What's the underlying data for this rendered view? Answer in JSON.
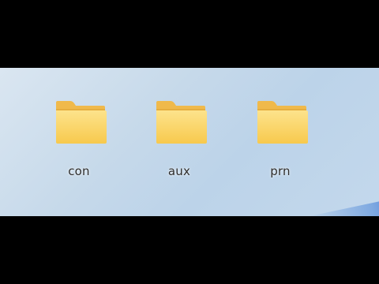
{
  "desktop": {
    "folders": [
      {
        "name": "con",
        "icon": "folder-icon"
      },
      {
        "name": "aux",
        "icon": "folder-icon"
      },
      {
        "name": "prn",
        "icon": "folder-icon"
      }
    ]
  },
  "colors": {
    "letterbox": "#000000",
    "folder_body": "#fcd66b",
    "folder_tab": "#f0b94b",
    "desktop_bg": "#c6d9ea"
  }
}
